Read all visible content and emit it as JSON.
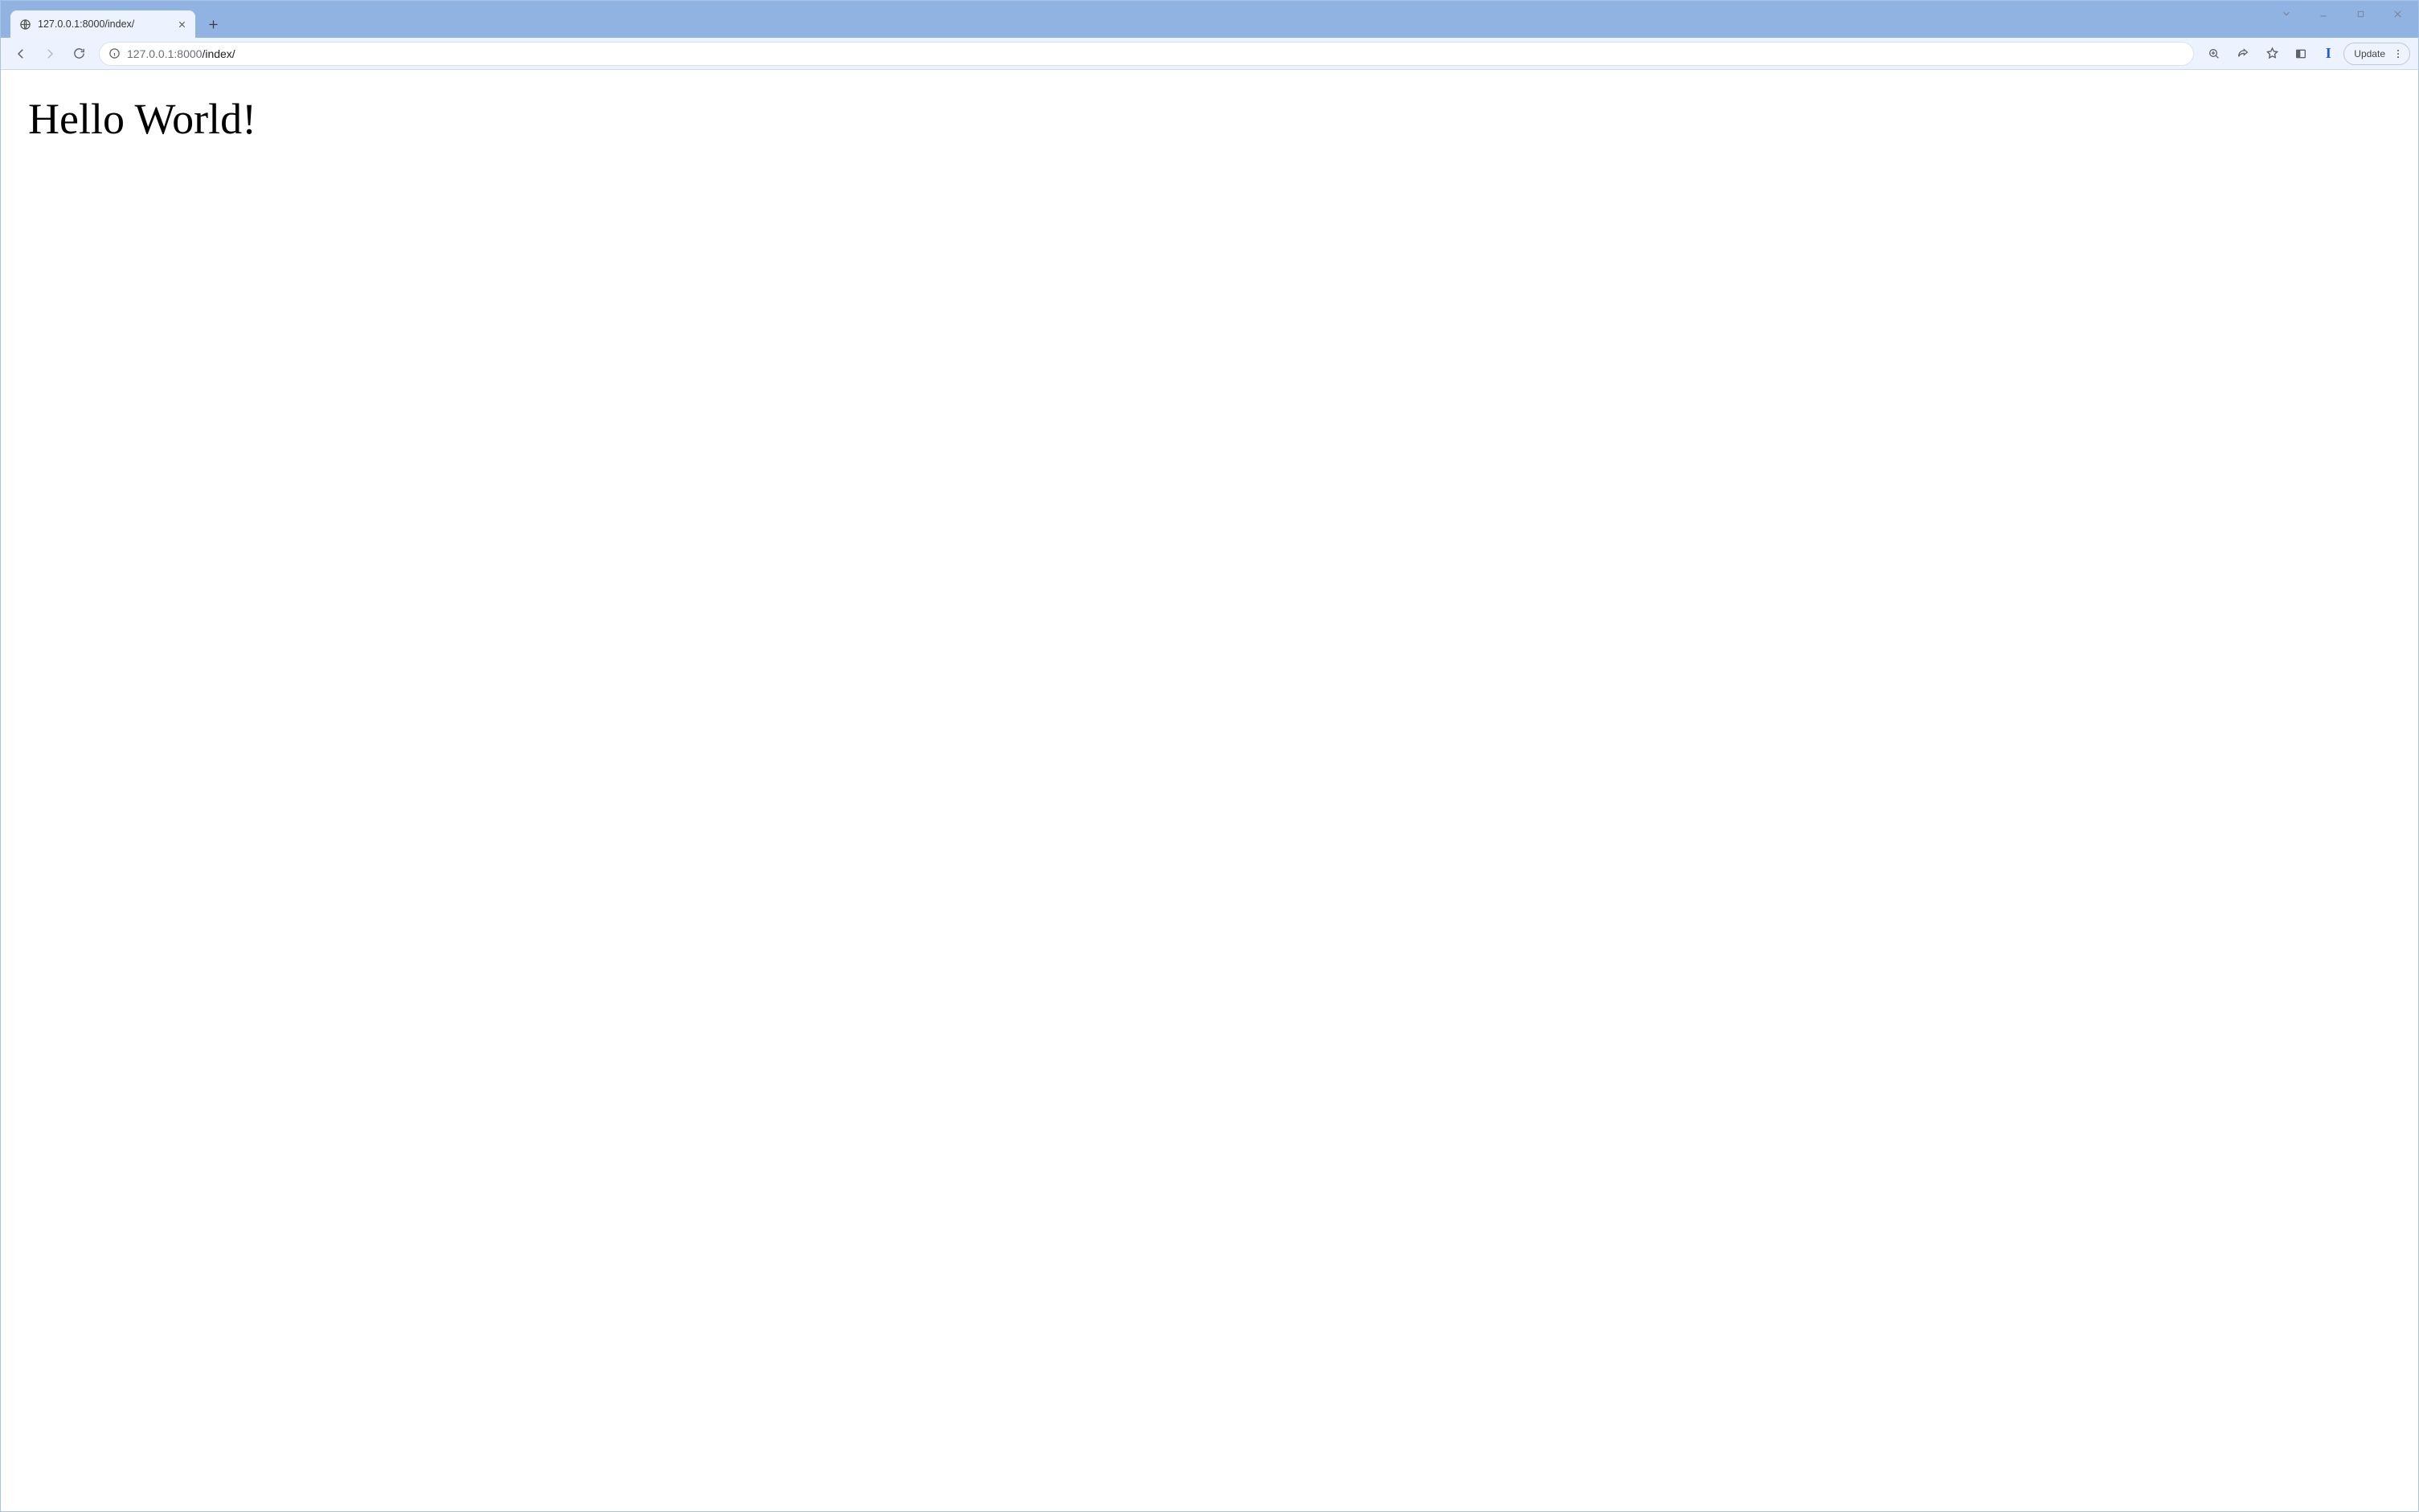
{
  "window": {
    "controls": {
      "dropdown": "chevron-down",
      "minimize": "minimize",
      "maximize": "maximize",
      "close": "close"
    }
  },
  "tab": {
    "title": "127.0.0.1:8000/index/",
    "favicon": "globe-icon",
    "close_icon": "x"
  },
  "new_tab_icon": "plus",
  "toolbar": {
    "back_icon": "arrow-left",
    "forward_icon": "arrow-right",
    "reload_icon": "reload",
    "site_info_icon": "info",
    "url": {
      "host": "127.0.0.1",
      "port": ":8000",
      "path": "/index/"
    },
    "right": {
      "zoom_icon": "zoom",
      "share_icon": "share",
      "bookmark_icon": "star",
      "panel_icon": "side-panel",
      "extension_label": "I",
      "update_label": "Update",
      "kebab_icon": "dots-vertical"
    }
  },
  "page": {
    "heading": "Hello World!"
  }
}
